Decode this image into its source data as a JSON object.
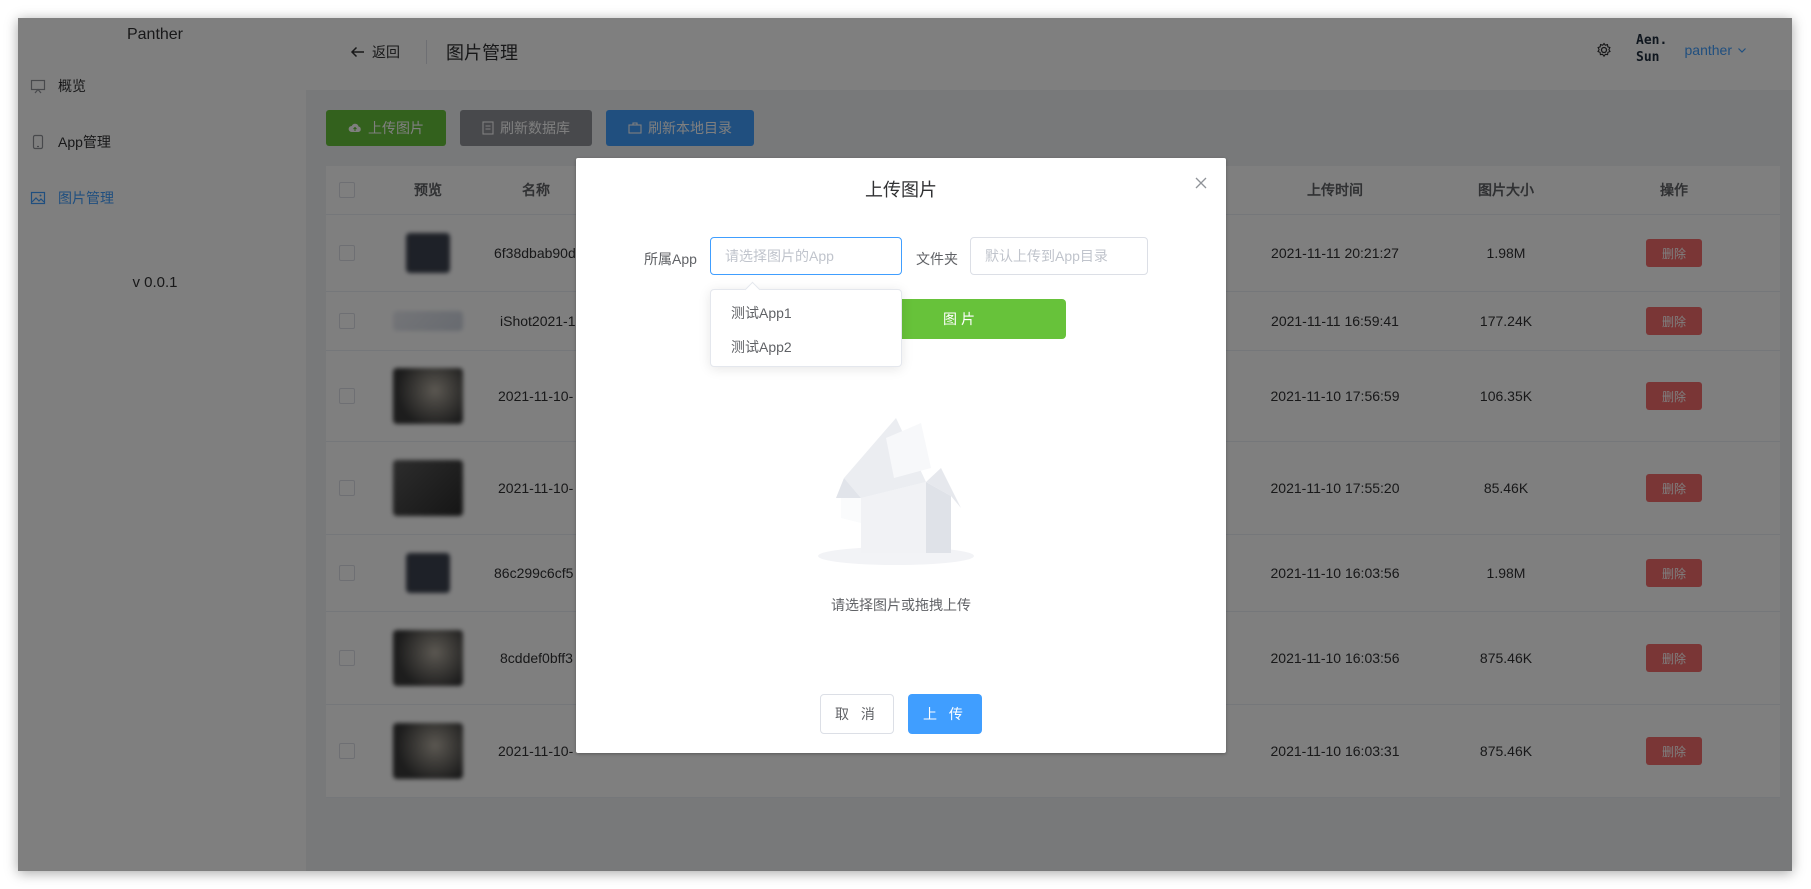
{
  "sidebar": {
    "brand": "Panther",
    "items": [
      {
        "label": "概览",
        "icon": "monitor-icon"
      },
      {
        "label": "App管理",
        "icon": "phone-icon"
      },
      {
        "label": "图片管理",
        "icon": "image-icon",
        "active": true
      }
    ],
    "version": "v 0.0.1"
  },
  "header": {
    "back_label": "返回",
    "title": "图片管理",
    "avatar_text": [
      "Aen.",
      "Sun"
    ],
    "username": "panther"
  },
  "toolbar": {
    "upload_label": "上传图片",
    "refresh_db_label": "刷新数据库",
    "refresh_local_label": "刷新本地目录"
  },
  "table": {
    "columns": {
      "preview": "预览",
      "name": "名称",
      "time": "上传时间",
      "size": "图片大小",
      "op": "操作"
    },
    "delete_label": "删除",
    "rows": [
      {
        "name": "6f38dbab90d",
        "time": "2021-11-11 20:21:27",
        "size": "1.98M"
      },
      {
        "name": "iShot2021-1",
        "time": "2021-11-11 16:59:41",
        "size": "177.24K"
      },
      {
        "name": "2021-11-10-",
        "time": "2021-11-10 17:56:59",
        "size": "106.35K"
      },
      {
        "name": "2021-11-10-",
        "time": "2021-11-10 17:55:20",
        "size": "85.46K"
      },
      {
        "name": "86c299c6cf5",
        "time": "2021-11-10 16:03:56",
        "size": "1.98M"
      },
      {
        "name": "8cddef0bff3",
        "time": "2021-11-10 16:03:56",
        "size": "875.46K"
      },
      {
        "name": "2021-11-10-",
        "time": "2021-11-10 16:03:31",
        "size": "875.46K"
      }
    ]
  },
  "dialog": {
    "title": "上传图片",
    "app_label": "所属App",
    "app_placeholder": "请选择图片的App",
    "folder_label": "文件夹",
    "folder_placeholder": "默认上传到App目录",
    "app_options": [
      "测试App1",
      "测试App2"
    ],
    "select_button": "图片",
    "upload_hint": "请选择图片或拖拽上传",
    "cancel_label": "取 消",
    "ok_label": "上 传"
  },
  "colors": {
    "primary": "#409eff",
    "success": "#67c23a",
    "danger": "#f56c6c",
    "info": "#909399"
  }
}
